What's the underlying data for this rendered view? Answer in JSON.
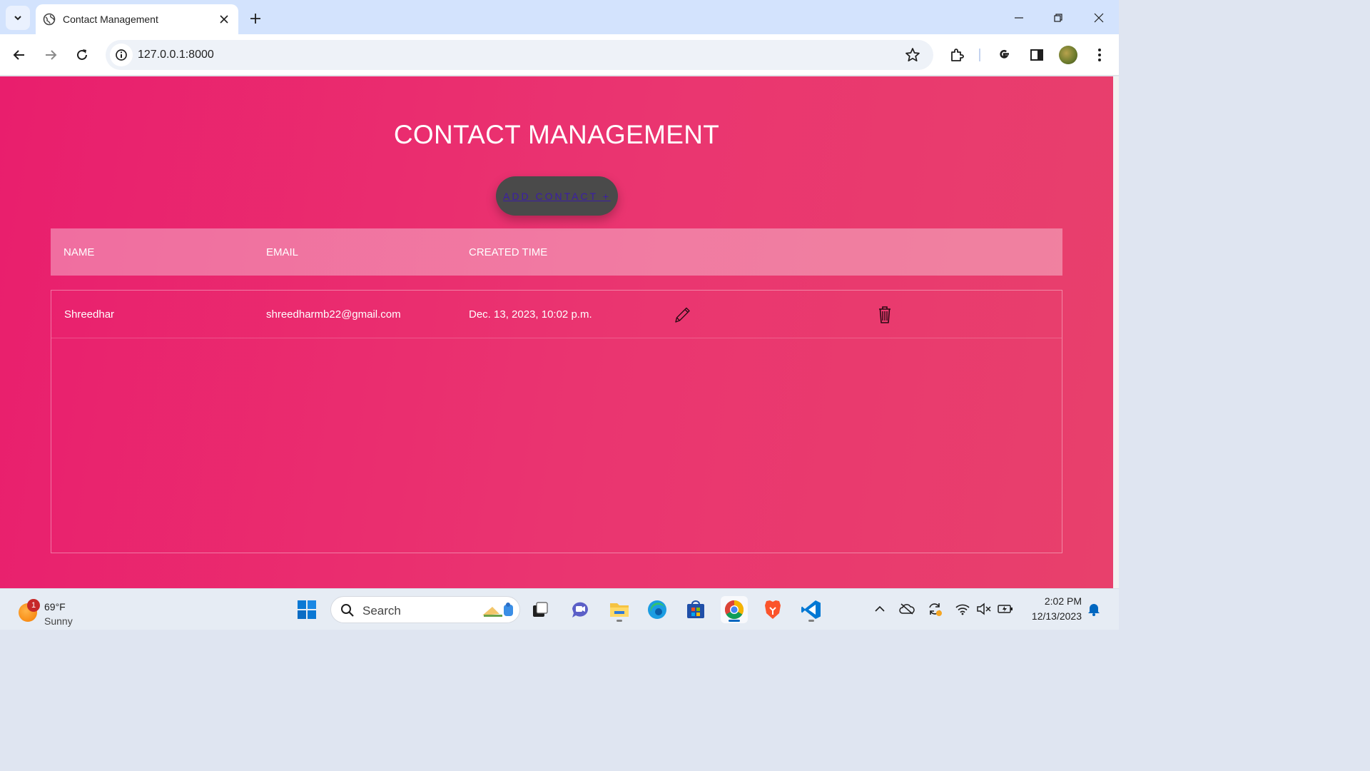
{
  "browser": {
    "tab_title": "Contact Management",
    "url": "127.0.0.1:8000"
  },
  "page": {
    "title": "CONTACT MANAGEMENT",
    "add_button_label": "ADD CONTACT +",
    "columns": [
      "NAME",
      "EMAIL",
      "CREATED TIME"
    ],
    "rows": [
      {
        "name": "Shreedhar",
        "email": "shreedharmb22@gmail.com",
        "created": "Dec. 13, 2023, 10:02 p.m."
      }
    ]
  },
  "taskbar": {
    "weather_badge": "1",
    "weather_temp": "69°F",
    "weather_desc": "Sunny",
    "search_placeholder": "Search",
    "time": "2:02 PM",
    "date": "12/13/2023"
  },
  "colors": {
    "page_gradient_start": "#e91e6d",
    "page_gradient_end": "#e8406c",
    "button_bg": "#4a4a4a",
    "button_link": "#3b1ea6"
  }
}
